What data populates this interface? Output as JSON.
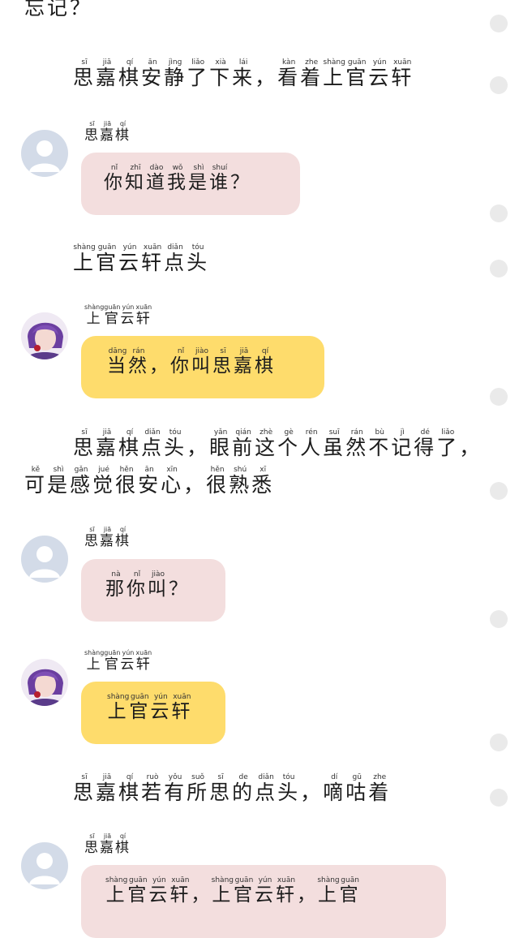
{
  "lines": [
    {
      "id": "l0",
      "segments": [
        [
          "忘",
          "wàng"
        ],
        [
          "记",
          "jì"
        ],
        [
          "？",
          ""
        ]
      ]
    },
    {
      "id": "l1",
      "segments": [
        [
          "思",
          "sī"
        ],
        [
          "嘉",
          "jiā"
        ],
        [
          "棋",
          "qí"
        ],
        [
          "安",
          "ān"
        ],
        [
          "静",
          "jìng"
        ],
        [
          "了",
          "liǎo"
        ],
        [
          "下",
          "xià"
        ],
        [
          "来",
          "lái"
        ],
        [
          "，",
          ""
        ],
        [
          "看",
          "kàn"
        ],
        [
          "着",
          "zhe"
        ],
        [
          "上",
          "shàng"
        ],
        [
          "官",
          "guān"
        ],
        [
          "云",
          "yún"
        ],
        [
          "轩",
          "xuān"
        ]
      ]
    },
    {
      "id": "n1",
      "segments": [
        [
          "思",
          "sī"
        ],
        [
          "嘉",
          "jiā"
        ],
        [
          "棋",
          "qí"
        ]
      ]
    },
    {
      "id": "b1",
      "segments": [
        [
          "你",
          "nǐ"
        ],
        [
          "知",
          "zhī"
        ],
        [
          "道",
          "dào"
        ],
        [
          "我",
          "wǒ"
        ],
        [
          "是",
          "shì"
        ],
        [
          "谁",
          "shuí"
        ],
        [
          "？",
          ""
        ]
      ]
    },
    {
      "id": "l2",
      "segments": [
        [
          "上",
          "shàng"
        ],
        [
          "官",
          "guān"
        ],
        [
          "云",
          "yún"
        ],
        [
          "轩",
          "xuān"
        ],
        [
          "点",
          "diǎn"
        ],
        [
          "头",
          "tóu"
        ]
      ]
    },
    {
      "id": "n2",
      "segments": [
        [
          "上",
          "shàng"
        ],
        [
          "官",
          "guān"
        ],
        [
          "云",
          "yún"
        ],
        [
          "轩",
          "xuān"
        ]
      ]
    },
    {
      "id": "b2",
      "segments": [
        [
          "当",
          "dāng"
        ],
        [
          "然",
          "rán"
        ],
        [
          "，",
          ""
        ],
        [
          "你",
          "nǐ"
        ],
        [
          "叫",
          "jiào"
        ],
        [
          "思",
          "sī"
        ],
        [
          "嘉",
          "jiā"
        ],
        [
          "棋",
          "qí"
        ]
      ]
    },
    {
      "id": "l3",
      "segments": [
        [
          "思",
          "sī"
        ],
        [
          "嘉",
          "jiā"
        ],
        [
          "棋",
          "qí"
        ],
        [
          "点",
          "diǎn"
        ],
        [
          "头",
          "tóu"
        ],
        [
          "，",
          ""
        ],
        [
          "眼",
          "yǎn"
        ],
        [
          "前",
          "qián"
        ],
        [
          "这",
          "zhè"
        ],
        [
          "个",
          "gè"
        ],
        [
          "人",
          "rén"
        ],
        [
          "虽",
          "suī"
        ],
        [
          "然",
          "rán"
        ],
        [
          "不",
          "bù"
        ],
        [
          "记",
          "jì"
        ],
        [
          "得",
          "dé"
        ],
        [
          "了",
          "liǎo"
        ],
        [
          "，",
          ""
        ],
        [
          "可",
          "kě"
        ],
        [
          "是",
          "shì"
        ],
        [
          "感",
          "gǎn"
        ],
        [
          "觉",
          "jué"
        ],
        [
          "很",
          "hěn"
        ],
        [
          "安",
          "ān"
        ],
        [
          "心",
          "xīn"
        ],
        [
          "，",
          ""
        ],
        [
          "很",
          "hěn"
        ],
        [
          "熟",
          "shú"
        ],
        [
          "悉",
          "xī"
        ]
      ]
    },
    {
      "id": "n3",
      "segments": [
        [
          "思",
          "sī"
        ],
        [
          "嘉",
          "jiā"
        ],
        [
          "棋",
          "qí"
        ]
      ]
    },
    {
      "id": "b3",
      "segments": [
        [
          "那",
          "nà"
        ],
        [
          "你",
          "nǐ"
        ],
        [
          "叫",
          "jiào"
        ],
        [
          "？",
          ""
        ]
      ]
    },
    {
      "id": "n4",
      "segments": [
        [
          "上",
          "shàng"
        ],
        [
          "官",
          "guān"
        ],
        [
          "云",
          "yún"
        ],
        [
          "轩",
          "xuān"
        ]
      ]
    },
    {
      "id": "b4",
      "segments": [
        [
          "上",
          "shàng"
        ],
        [
          "官",
          "guān"
        ],
        [
          "云",
          "yún"
        ],
        [
          "轩",
          "xuān"
        ]
      ]
    },
    {
      "id": "l4",
      "segments": [
        [
          "思",
          "sī"
        ],
        [
          "嘉",
          "jiā"
        ],
        [
          "棋",
          "qí"
        ],
        [
          "若",
          "ruò"
        ],
        [
          "有",
          "yǒu"
        ],
        [
          "所",
          "suǒ"
        ],
        [
          "思",
          "sī"
        ],
        [
          "的",
          "de"
        ],
        [
          "点",
          "diǎn"
        ],
        [
          "头",
          "tóu"
        ],
        [
          "，",
          ""
        ],
        [
          "嘀",
          "dí"
        ],
        [
          "咕",
          "gū"
        ],
        [
          "着",
          "zhe"
        ]
      ]
    },
    {
      "id": "n5",
      "segments": [
        [
          "思",
          "sī"
        ],
        [
          "嘉",
          "jiā"
        ],
        [
          "棋",
          "qí"
        ]
      ]
    },
    {
      "id": "b5",
      "segments": [
        [
          "上",
          "shàng"
        ],
        [
          "官",
          "guān"
        ],
        [
          "云",
          "yún"
        ],
        [
          "轩",
          "xuān"
        ],
        [
          "，",
          ""
        ],
        [
          "上",
          "shàng"
        ],
        [
          "官",
          "guān"
        ],
        [
          "云",
          "yún"
        ],
        [
          "轩",
          "xuān"
        ],
        [
          "，",
          ""
        ],
        [
          "上",
          "shàng"
        ],
        [
          "官",
          "guān"
        ]
      ]
    }
  ],
  "colors": {
    "bubble_pink": "#f3dede",
    "bubble_yellow": "#fedc6c",
    "avatar_default": "#d3dbe8",
    "dot": "#eaeaea"
  },
  "icons": {
    "default_avatar": "person-silhouette-icon",
    "character_avatar": "character-portrait-icon"
  }
}
